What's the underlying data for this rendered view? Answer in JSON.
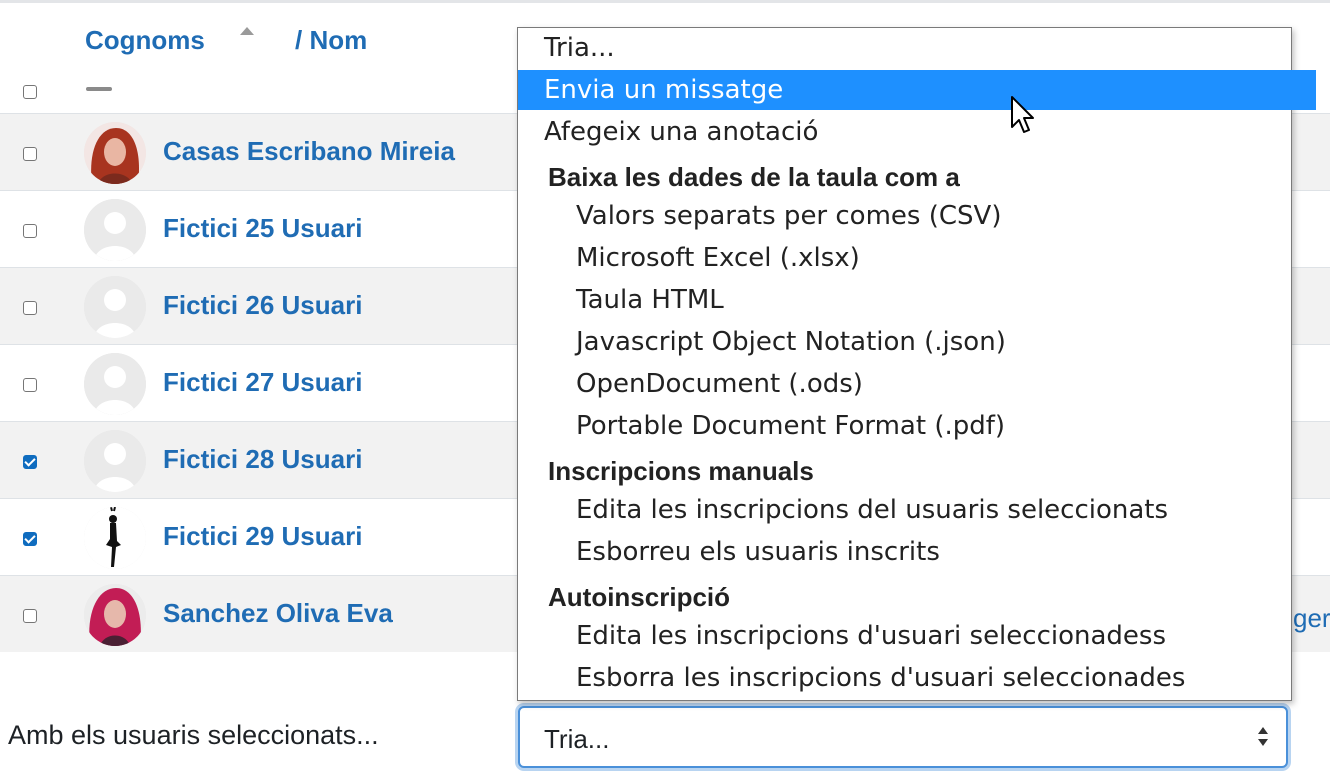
{
  "table": {
    "header": {
      "sort_lastname": "Cognoms",
      "sort_firstname": "/ Nom"
    },
    "rows": [
      {
        "name": "Casas Escribano Mireia",
        "checked": false,
        "avatar": "photo-red-hair"
      },
      {
        "name": "Fictici 25 Usuari",
        "checked": false,
        "avatar": "default-user"
      },
      {
        "name": "Fictici 26 Usuari",
        "checked": false,
        "avatar": "default-user"
      },
      {
        "name": "Fictici 27 Usuari",
        "checked": false,
        "avatar": "default-user"
      },
      {
        "name": "Fictici 28 Usuari",
        "checked": true,
        "avatar": "default-user"
      },
      {
        "name": "Fictici 29 Usuari",
        "checked": true,
        "avatar": "dancer-silhouette"
      },
      {
        "name": "Sanchez Oliva Eva",
        "checked": false,
        "avatar": "photo-pink-hair"
      }
    ],
    "trailing_fragment": "ger"
  },
  "bulk_action": {
    "label": "Amb els usuaris seleccionats...",
    "selected": "Tria...",
    "options": [
      {
        "text": "Tria...",
        "level": 0
      },
      {
        "text": "Envia un missatge",
        "level": 0,
        "highlighted": true
      },
      {
        "text": "Afegeix una anotació",
        "level": 0
      },
      {
        "text": "Baixa les dades de la taula com a",
        "group": true
      },
      {
        "text": "Valors separats per comes (CSV)",
        "level": 1
      },
      {
        "text": "Microsoft Excel (.xlsx)",
        "level": 1
      },
      {
        "text": "Taula HTML",
        "level": 1
      },
      {
        "text": "Javascript Object Notation (.json)",
        "level": 1
      },
      {
        "text": "OpenDocument (.ods)",
        "level": 1
      },
      {
        "text": "Portable Document Format (.pdf)",
        "level": 1
      },
      {
        "text": "Inscripcions manuals",
        "group": true
      },
      {
        "text": "Edita les inscripcions del usuaris seleccionats",
        "level": 1
      },
      {
        "text": "Esborreu els usuaris inscrits",
        "level": 1
      },
      {
        "text": "Autoinscripció",
        "group": true
      },
      {
        "text": "Edita les inscripcions d'usuari seleccionadess",
        "level": 1
      },
      {
        "text": "Esborra les inscripcions d'usuari seleccionades",
        "level": 1
      }
    ]
  },
  "colors": {
    "link": "#1f6cb4",
    "highlight": "#1e90ff",
    "checkbox_checked": "#0f6cbf",
    "row_stripe": "#f2f2f2"
  }
}
